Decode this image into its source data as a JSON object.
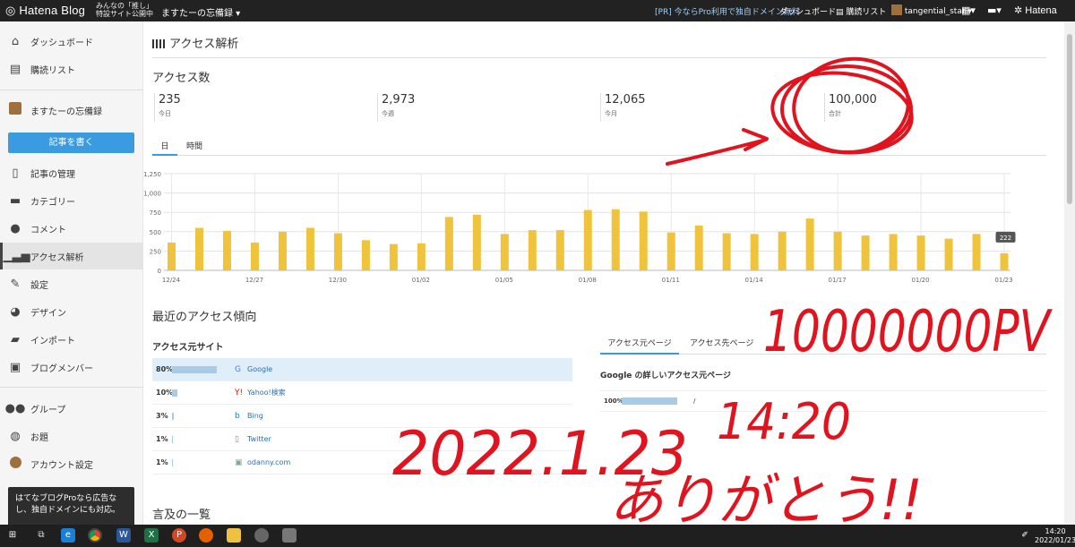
{
  "topbar": {
    "brand": "Hatena Blog",
    "promo_line1": "みんなの「推し」",
    "promo_line2": "特設サイト公開中",
    "blog_select": "ますたーの忘備録 ▾",
    "pr_link": "[PR] 今ならPro利用で独自ドメイン無料",
    "dashboard": "ダッシュボード",
    "reader": "購読リスト",
    "user": "tangential_star ▾",
    "hatena": "Hatena"
  },
  "sidebar": {
    "items": [
      {
        "label": "ダッシュボード",
        "icon": "home-icon"
      },
      {
        "label": "購読リスト",
        "icon": "reader-icon"
      },
      {
        "label": "ますたーの忘備録",
        "icon": "blog-thumb-icon"
      },
      {
        "label": "記事の管理",
        "icon": "document-icon"
      },
      {
        "label": "カテゴリー",
        "icon": "folder-icon"
      },
      {
        "label": "コメント",
        "icon": "comment-icon"
      },
      {
        "label": "アクセス解析",
        "icon": "bar-chart-icon"
      },
      {
        "label": "設定",
        "icon": "wrench-icon"
      },
      {
        "label": "デザイン",
        "icon": "palette-icon"
      },
      {
        "label": "インポート",
        "icon": "truck-icon"
      },
      {
        "label": "ブログメンバー",
        "icon": "members-icon"
      },
      {
        "label": "グループ",
        "icon": "group-icon"
      },
      {
        "label": "お題",
        "icon": "topic-icon"
      },
      {
        "label": "アカウント設定",
        "icon": "avatar-icon"
      }
    ],
    "write_button": "記事を書く",
    "pro_line1": "はてなブログProなら広告な",
    "pro_line2": "し、独自ドメインにも対応。"
  },
  "main": {
    "title": "アクセス解析",
    "count_heading": "アクセス数",
    "stats": [
      {
        "value": "235",
        "label": "今日"
      },
      {
        "value": "2,973",
        "label": "今週"
      },
      {
        "value": "12,065",
        "label": "今月"
      },
      {
        "value": "100,000",
        "label": "合計"
      }
    ],
    "tabs": [
      "日",
      "時間"
    ],
    "recent_heading": "最近のアクセス傾向",
    "sources_heading": "アクセス元サイト",
    "sources": [
      {
        "pct": "80%",
        "frac": 0.8,
        "name": "Google",
        "icon": "google-icon"
      },
      {
        "pct": "10%",
        "frac": 0.1,
        "name": "Yahoo!検索",
        "icon": "yahoo-icon"
      },
      {
        "pct": "3%",
        "frac": 0.03,
        "name": "Bing",
        "icon": "bing-icon"
      },
      {
        "pct": "1%",
        "frac": 0.01,
        "name": "Twitter",
        "icon": "twitter-icon"
      },
      {
        "pct": "1%",
        "frac": 0.01,
        "name": "odanny.com",
        "icon": "site-icon"
      }
    ],
    "page_tabs": [
      "アクセス元ページ",
      "アクセス先ページ"
    ],
    "google_detail_heading": "Google の詳しいアクセス元ページ",
    "google_row": {
      "pct": "100%",
      "frac": 1.0,
      "path": "/"
    },
    "mentions_heading": "言及の一覧"
  },
  "chart_data": {
    "type": "bar",
    "ylim": [
      0,
      1250
    ],
    "yticks": [
      "0",
      "250",
      "500",
      "750",
      "1,000",
      "1,250"
    ],
    "categories": [
      "12/24",
      "12/25",
      "12/26",
      "12/27",
      "12/28",
      "12/29",
      "12/30",
      "12/31",
      "01/01",
      "01/02",
      "01/03",
      "01/04",
      "01/05",
      "01/06",
      "01/07",
      "01/08",
      "01/09",
      "01/10",
      "01/11",
      "01/12",
      "01/13",
      "01/14",
      "01/15",
      "01/16",
      "01/17",
      "01/18",
      "01/19",
      "01/20",
      "01/21",
      "01/22",
      "01/23"
    ],
    "xtick_labels": [
      "12/24",
      "12/27",
      "12/30",
      "01/02",
      "01/05",
      "01/08",
      "01/11",
      "01/14",
      "01/17",
      "01/20",
      "01/23"
    ],
    "values": [
      360,
      550,
      510,
      360,
      500,
      550,
      480,
      390,
      340,
      350,
      690,
      720,
      470,
      520,
      520,
      780,
      790,
      760,
      490,
      580,
      480,
      470,
      500,
      670,
      500,
      450,
      470,
      450,
      410,
      470,
      222
    ],
    "tooltip": "222",
    "bar_color": "#f0c33c"
  },
  "annotations": {
    "big_number": "10000000PV",
    "date": "2022.1.23",
    "time": "14:20",
    "thanks": "ありがとう!!",
    "ink_color": "#e0141e"
  },
  "taskbar": {
    "time": "14:20",
    "date": "2022/01/23"
  }
}
